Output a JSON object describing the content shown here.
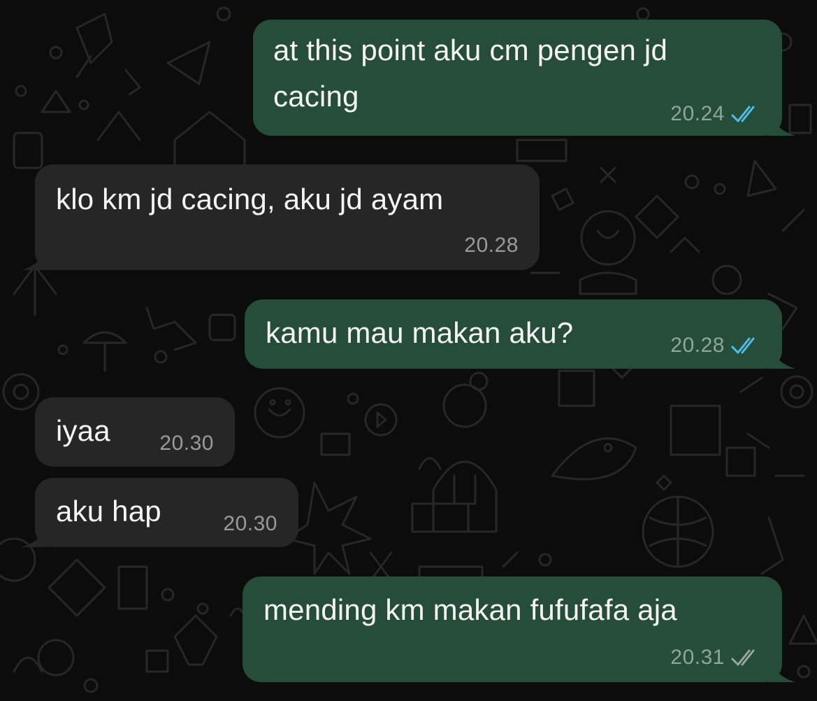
{
  "messages": [
    {
      "direction": "outgoing",
      "text_line1": "at this point aku cm pengen jd",
      "text_line2": "cacing",
      "time": "20.24",
      "status": "read"
    },
    {
      "direction": "incoming",
      "text": "klo km jd cacing, aku jd ayam",
      "time": "20.28"
    },
    {
      "direction": "outgoing",
      "text": "kamu mau makan aku?",
      "time": "20.28",
      "status": "read"
    },
    {
      "direction": "incoming",
      "text": "iyaa",
      "time": "20.30"
    },
    {
      "direction": "incoming",
      "text": "aku hap",
      "time": "20.30"
    },
    {
      "direction": "outgoing",
      "text": "mending km makan fufufafa aja",
      "time": "20.31",
      "status": "delivered"
    }
  ],
  "colors": {
    "background": "#0c0c0c",
    "outgoing_bubble": "#254d3a",
    "incoming_bubble": "#262626",
    "read_ticks": "#53bdeb",
    "delivered_ticks": "#9aa8a0"
  }
}
